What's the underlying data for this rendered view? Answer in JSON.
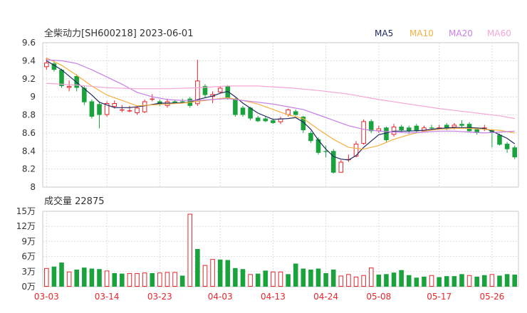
{
  "header": {
    "title": "全柴动力[SH600218] 2023-06-01"
  },
  "legend": [
    {
      "label": "MA5",
      "color": "#1f2a63"
    },
    {
      "label": "MA10",
      "color": "#f5b041"
    },
    {
      "label": "MA20",
      "color": "#c77ee6"
    },
    {
      "label": "MA60",
      "color": "#f4a6d6"
    }
  ],
  "volume_header": {
    "label": "成交量 22875"
  },
  "colors": {
    "up": "#e8262d",
    "down": "#1aa33c",
    "grid": "#dcdcdc",
    "axis": "#c8c8c8"
  },
  "chart_data": {
    "type": "candlestick",
    "price_axis": {
      "ticks": [
        "9.6",
        "9.4",
        "9.2",
        "9",
        "8.8",
        "8.6",
        "8.4",
        "8.2",
        "8"
      ],
      "min": 8.0,
      "max": 9.6
    },
    "volume_axis": {
      "ticks": [
        "15万",
        "12万",
        "9万",
        "6万",
        "3万",
        "0万"
      ],
      "min": 0,
      "max": 150000
    },
    "x_tick_labels": [
      {
        "index": 0,
        "label": "03-03"
      },
      {
        "index": 8,
        "label": "03-14"
      },
      {
        "index": 15,
        "label": "03-23"
      },
      {
        "index": 23,
        "label": "04-03"
      },
      {
        "index": 30,
        "label": "04-13"
      },
      {
        "index": 37,
        "label": "04-24"
      },
      {
        "index": 44,
        "label": "05-08"
      },
      {
        "index": 52,
        "label": "05-17"
      },
      {
        "index": 59,
        "label": "05-26"
      }
    ],
    "ohlc": [
      [
        9.33,
        9.38,
        9.43,
        9.3
      ],
      [
        9.37,
        9.3,
        9.4,
        9.28
      ],
      [
        9.3,
        9.12,
        9.31,
        9.1
      ],
      [
        9.1,
        9.12,
        9.18,
        9.06
      ],
      [
        9.23,
        9.1,
        9.25,
        9.06
      ],
      [
        9.1,
        8.94,
        9.12,
        8.91
      ],
      [
        8.95,
        8.78,
        8.97,
        8.76
      ],
      [
        8.92,
        8.8,
        8.95,
        8.65
      ],
      [
        8.8,
        8.93,
        8.95,
        8.78
      ],
      [
        8.89,
        8.93,
        8.96,
        8.87
      ],
      [
        8.86,
        8.86,
        8.91,
        8.83
      ],
      [
        8.85,
        8.85,
        8.9,
        8.83
      ],
      [
        8.82,
        8.88,
        8.9,
        8.8
      ],
      [
        8.83,
        8.95,
        8.97,
        8.82
      ],
      [
        8.97,
        8.98,
        9.03,
        8.95
      ],
      [
        8.95,
        8.92,
        8.97,
        8.9
      ],
      [
        8.9,
        8.95,
        8.98,
        8.88
      ],
      [
        8.95,
        8.93,
        8.97,
        8.92
      ],
      [
        8.95,
        8.94,
        8.98,
        8.93
      ],
      [
        8.98,
        8.9,
        9.0,
        8.88
      ],
      [
        8.92,
        9.18,
        9.41,
        8.9
      ],
      [
        9.12,
        9.02,
        9.14,
        8.99
      ],
      [
        9.0,
        9.03,
        9.06,
        8.93
      ],
      [
        9.05,
        9.1,
        9.12,
        9.04
      ],
      [
        9.12,
        8.98,
        9.13,
        8.97
      ],
      [
        8.98,
        8.8,
        8.99,
        8.78
      ],
      [
        8.88,
        8.8,
        8.9,
        8.78
      ],
      [
        8.88,
        8.76,
        8.89,
        8.74
      ],
      [
        8.77,
        8.73,
        8.79,
        8.72
      ],
      [
        8.76,
        8.73,
        8.78,
        8.72
      ],
      [
        8.74,
        8.71,
        8.76,
        8.7
      ],
      [
        8.72,
        8.76,
        8.78,
        8.7
      ],
      [
        8.8,
        8.86,
        8.87,
        8.78
      ],
      [
        8.84,
        8.8,
        8.86,
        8.79
      ],
      [
        8.78,
        8.63,
        8.79,
        8.6
      ],
      [
        8.6,
        8.51,
        8.62,
        8.49
      ],
      [
        8.53,
        8.38,
        8.55,
        8.36
      ],
      [
        8.4,
        8.39,
        8.46,
        8.33
      ],
      [
        8.4,
        8.16,
        8.42,
        8.15
      ],
      [
        8.16,
        8.28,
        8.3,
        8.17
      ],
      [
        8.3,
        8.31,
        8.36,
        8.28
      ],
      [
        8.34,
        8.48,
        8.51,
        8.33
      ],
      [
        8.48,
        8.73,
        8.75,
        8.47
      ],
      [
        8.73,
        8.62,
        8.75,
        8.6
      ],
      [
        8.62,
        8.65,
        8.68,
        8.6
      ],
      [
        8.66,
        8.52,
        8.67,
        8.5
      ],
      [
        8.58,
        8.67,
        8.7,
        8.56
      ],
      [
        8.67,
        8.63,
        8.69,
        8.61
      ],
      [
        8.66,
        8.62,
        8.68,
        8.59
      ],
      [
        8.68,
        8.62,
        8.7,
        8.6
      ],
      [
        8.62,
        8.66,
        8.68,
        8.61
      ],
      [
        8.66,
        8.65,
        8.69,
        8.63
      ],
      [
        8.66,
        8.66,
        8.69,
        8.64
      ],
      [
        8.69,
        8.65,
        8.71,
        8.63
      ],
      [
        8.66,
        8.69,
        8.71,
        8.64
      ],
      [
        8.7,
        8.68,
        8.74,
        8.66
      ],
      [
        8.7,
        8.62,
        8.72,
        8.61
      ],
      [
        8.64,
        8.6,
        8.65,
        8.58
      ],
      [
        8.64,
        8.66,
        8.69,
        8.62
      ],
      [
        8.63,
        8.6,
        8.64,
        8.44
      ],
      [
        8.58,
        8.47,
        8.59,
        8.46
      ],
      [
        8.48,
        8.42,
        8.5,
        8.38
      ],
      [
        8.44,
        8.33,
        8.46,
        8.31
      ]
    ],
    "ma": {
      "MA5": [
        [
          0,
          9.4
        ],
        [
          2,
          9.3
        ],
        [
          4,
          9.16
        ],
        [
          6,
          9.02
        ],
        [
          7,
          8.94
        ],
        [
          9,
          8.88
        ],
        [
          11,
          8.88
        ],
        [
          13,
          8.9
        ],
        [
          15,
          8.93
        ],
        [
          17,
          8.93
        ],
        [
          19,
          8.94
        ],
        [
          20,
          8.97
        ],
        [
          22,
          9.01
        ],
        [
          23,
          9.04
        ],
        [
          24,
          9.06
        ],
        [
          25,
          9.0
        ],
        [
          26,
          8.93
        ],
        [
          28,
          8.82
        ],
        [
          30,
          8.75
        ],
        [
          32,
          8.76
        ],
        [
          33,
          8.77
        ],
        [
          34,
          8.72
        ],
        [
          35,
          8.64
        ],
        [
          36,
          8.52
        ],
        [
          37,
          8.42
        ],
        [
          38,
          8.34
        ],
        [
          39,
          8.31
        ],
        [
          40,
          8.3
        ],
        [
          41,
          8.35
        ],
        [
          42,
          8.44
        ],
        [
          43,
          8.51
        ],
        [
          44,
          8.58
        ],
        [
          45,
          8.6
        ],
        [
          46,
          8.62
        ],
        [
          48,
          8.62
        ],
        [
          50,
          8.63
        ],
        [
          52,
          8.65
        ],
        [
          54,
          8.66
        ],
        [
          56,
          8.66
        ],
        [
          58,
          8.65
        ],
        [
          59,
          8.62
        ],
        [
          61,
          8.54
        ],
        [
          62,
          8.48
        ]
      ],
      "MA10": [
        [
          0,
          9.43
        ],
        [
          2,
          9.35
        ],
        [
          4,
          9.24
        ],
        [
          6,
          9.12
        ],
        [
          8,
          9.02
        ],
        [
          10,
          8.96
        ],
        [
          12,
          8.9
        ],
        [
          14,
          8.91
        ],
        [
          16,
          8.92
        ],
        [
          18,
          8.93
        ],
        [
          20,
          8.95
        ],
        [
          22,
          8.97
        ],
        [
          24,
          8.99
        ],
        [
          26,
          8.96
        ],
        [
          28,
          8.92
        ],
        [
          30,
          8.86
        ],
        [
          32,
          8.8
        ],
        [
          34,
          8.76
        ],
        [
          36,
          8.64
        ],
        [
          38,
          8.53
        ],
        [
          40,
          8.44
        ],
        [
          42,
          8.42
        ],
        [
          44,
          8.46
        ],
        [
          46,
          8.53
        ],
        [
          48,
          8.58
        ],
        [
          50,
          8.62
        ],
        [
          52,
          8.64
        ],
        [
          54,
          8.65
        ],
        [
          56,
          8.65
        ],
        [
          58,
          8.64
        ],
        [
          60,
          8.63
        ],
        [
          62,
          8.6
        ]
      ],
      "MA20": [
        [
          0,
          9.41
        ],
        [
          2,
          9.4
        ],
        [
          4,
          9.37
        ],
        [
          6,
          9.3
        ],
        [
          8,
          9.22
        ],
        [
          10,
          9.14
        ],
        [
          12,
          9.05
        ],
        [
          14,
          9.0
        ],
        [
          16,
          8.97
        ],
        [
          18,
          8.96
        ],
        [
          20,
          8.96
        ],
        [
          22,
          8.97
        ],
        [
          24,
          8.98
        ],
        [
          26,
          8.96
        ],
        [
          28,
          8.94
        ],
        [
          30,
          8.92
        ],
        [
          32,
          8.89
        ],
        [
          34,
          8.86
        ],
        [
          36,
          8.8
        ],
        [
          38,
          8.74
        ],
        [
          40,
          8.68
        ],
        [
          42,
          8.64
        ],
        [
          44,
          8.62
        ],
        [
          46,
          8.61
        ],
        [
          48,
          8.6
        ],
        [
          50,
          8.61
        ],
        [
          52,
          8.62
        ],
        [
          54,
          8.62
        ],
        [
          56,
          8.61
        ],
        [
          58,
          8.6
        ],
        [
          60,
          8.61
        ],
        [
          62,
          8.62
        ]
      ],
      "MA60": [
        [
          0,
          9.15
        ],
        [
          4,
          9.13
        ],
        [
          8,
          9.1
        ],
        [
          12,
          9.09
        ],
        [
          16,
          9.09
        ],
        [
          20,
          9.1
        ],
        [
          24,
          9.12
        ],
        [
          28,
          9.12
        ],
        [
          32,
          9.1
        ],
        [
          36,
          9.07
        ],
        [
          40,
          9.03
        ],
        [
          44,
          8.97
        ],
        [
          48,
          8.92
        ],
        [
          52,
          8.87
        ],
        [
          56,
          8.83
        ],
        [
          60,
          8.79
        ],
        [
          62,
          8.76
        ]
      ]
    },
    "volume": [
      [
        37000,
        0
      ],
      [
        40000,
        1
      ],
      [
        48000,
        1
      ],
      [
        30000,
        0
      ],
      [
        34000,
        1
      ],
      [
        38000,
        1
      ],
      [
        36000,
        1
      ],
      [
        35000,
        1
      ],
      [
        32000,
        0
      ],
      [
        27000,
        1
      ],
      [
        26000,
        1
      ],
      [
        27000,
        0
      ],
      [
        27000,
        0
      ],
      [
        28000,
        0
      ],
      [
        27000,
        1
      ],
      [
        28000,
        0
      ],
      [
        29000,
        0
      ],
      [
        29000,
        0
      ],
      [
        22000,
        1
      ],
      [
        145000,
        0
      ],
      [
        75000,
        1
      ],
      [
        43000,
        0
      ],
      [
        55000,
        0
      ],
      [
        54000,
        1
      ],
      [
        53000,
        1
      ],
      [
        37000,
        1
      ],
      [
        35000,
        1
      ],
      [
        25000,
        0
      ],
      [
        26000,
        1
      ],
      [
        32000,
        1
      ],
      [
        30000,
        0
      ],
      [
        30000,
        0
      ],
      [
        25000,
        1
      ],
      [
        46000,
        1
      ],
      [
        36000,
        1
      ],
      [
        34000,
        1
      ],
      [
        36000,
        1
      ],
      [
        27000,
        1
      ],
      [
        34000,
        1
      ],
      [
        22000,
        0
      ],
      [
        25000,
        0
      ],
      [
        20000,
        0
      ],
      [
        23000,
        0
      ],
      [
        38000,
        0
      ],
      [
        24000,
        1
      ],
      [
        25000,
        1
      ],
      [
        28000,
        1
      ],
      [
        33000,
        1
      ],
      [
        23000,
        1
      ],
      [
        18000,
        1
      ],
      [
        20000,
        1
      ],
      [
        23000,
        0
      ],
      [
        19000,
        1
      ],
      [
        21000,
        1
      ],
      [
        21000,
        1
      ],
      [
        25000,
        1
      ],
      [
        23000,
        0
      ],
      [
        20000,
        1
      ],
      [
        23000,
        1
      ],
      [
        25000,
        0
      ],
      [
        22000,
        1
      ],
      [
        25000,
        1
      ],
      [
        24000,
        1
      ]
    ]
  }
}
